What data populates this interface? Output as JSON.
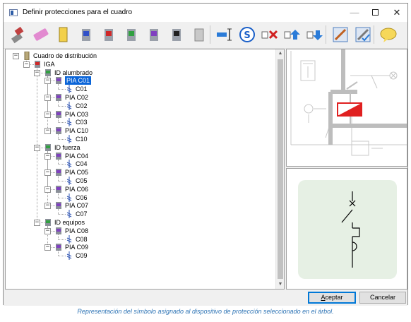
{
  "window": {
    "title": "Definir protecciones para el cuadro"
  },
  "toolbar": {
    "icons": [
      "eraser-brush-icon",
      "eraser-icon",
      "cabinet-yellow-icon",
      "breaker-blue-icon",
      "breaker-red-icon",
      "breaker-green-icon",
      "breaker-purple-icon",
      "breaker-black-icon",
      "breaker-grey-icon",
      "insert-line-icon",
      "symbol-s-icon",
      "delete-icon",
      "move-up-icon",
      "move-down-icon",
      "edit-icon",
      "edit-check-icon",
      "comment-icon"
    ]
  },
  "tree": {
    "nodes": [
      {
        "label": "Cuadro de distribución",
        "level": 0,
        "icon": "panel",
        "expander": "−"
      },
      {
        "label": "IGA",
        "level": 1,
        "icon": "breaker-red",
        "expander": "−"
      },
      {
        "label": "ID alumbrado",
        "level": 2,
        "icon": "breaker-green",
        "expander": "−"
      },
      {
        "label": "PIA C01",
        "level": 3,
        "icon": "breaker-purple",
        "expander": "−",
        "selected": true
      },
      {
        "label": "C01",
        "level": 4,
        "icon": "circuit"
      },
      {
        "label": "PIA C02",
        "level": 3,
        "icon": "breaker-purple",
        "expander": "−"
      },
      {
        "label": "C02",
        "level": 4,
        "icon": "circuit"
      },
      {
        "label": "PIA C03",
        "level": 3,
        "icon": "breaker-purple",
        "expander": "−"
      },
      {
        "label": "C03",
        "level": 4,
        "icon": "circuit"
      },
      {
        "label": "PIA C10",
        "level": 3,
        "icon": "breaker-purple",
        "expander": "−"
      },
      {
        "label": "C10",
        "level": 4,
        "icon": "circuit"
      },
      {
        "label": "ID fuerza",
        "level": 2,
        "icon": "breaker-green",
        "expander": "−"
      },
      {
        "label": "PIA C04",
        "level": 3,
        "icon": "breaker-purple",
        "expander": "−"
      },
      {
        "label": "C04",
        "level": 4,
        "icon": "circuit"
      },
      {
        "label": "PIA C05",
        "level": 3,
        "icon": "breaker-purple",
        "expander": "−"
      },
      {
        "label": "C05",
        "level": 4,
        "icon": "circuit"
      },
      {
        "label": "PIA C06",
        "level": 3,
        "icon": "breaker-purple",
        "expander": "−"
      },
      {
        "label": "C06",
        "level": 4,
        "icon": "circuit"
      },
      {
        "label": "PIA C07",
        "level": 3,
        "icon": "breaker-purple",
        "expander": "−"
      },
      {
        "label": "C07",
        "level": 4,
        "icon": "circuit"
      },
      {
        "label": "ID equipos",
        "level": 2,
        "icon": "breaker-green",
        "expander": "−"
      },
      {
        "label": "PIA C08",
        "level": 3,
        "icon": "breaker-purple",
        "expander": "−"
      },
      {
        "label": "C08",
        "level": 4,
        "icon": "circuit"
      },
      {
        "label": "PIA C09",
        "level": 3,
        "icon": "breaker-purple",
        "expander": "−"
      },
      {
        "label": "C09",
        "level": 4,
        "icon": "circuit"
      }
    ]
  },
  "buttons": {
    "ok_prefix": "A",
    "ok_rest": "ceptar",
    "cancel": "Cancelar"
  },
  "caption": "Representación del símbolo asignado al dispositivo de protección seleccionado en el árbol.",
  "colors": {
    "selection": "#0a64d8",
    "caption": "#2e74b5",
    "symbol_card": "#e6f0e4"
  }
}
